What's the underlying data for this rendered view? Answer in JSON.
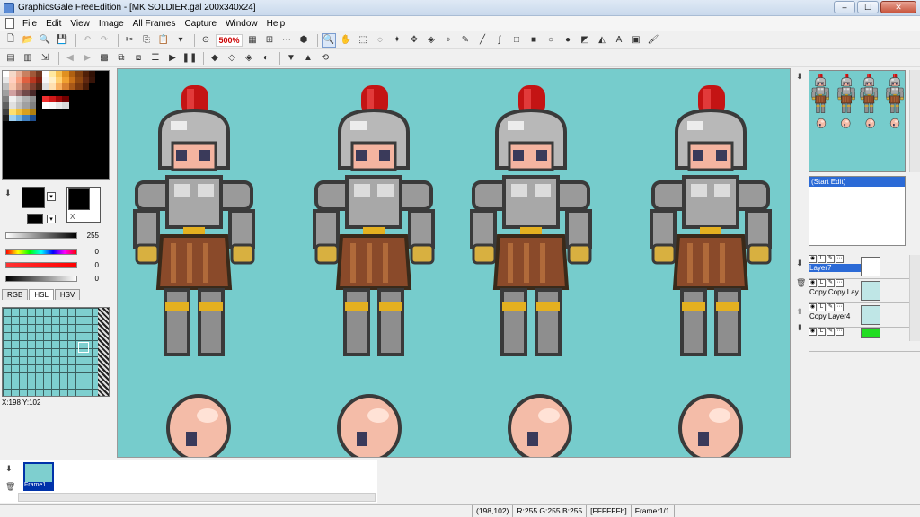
{
  "window": {
    "title": "GraphicsGale FreeEdition - [MK SOLDIER.gal 200x340x24]",
    "minimize": "–",
    "maximize": "☐",
    "close": "✕"
  },
  "menu": [
    "File",
    "Edit",
    "View",
    "Image",
    "All Frames",
    "Capture",
    "Window",
    "Help"
  ],
  "toolbar": {
    "zoom": "500%"
  },
  "colors": {
    "canvas_bg": "#76cccc",
    "selection": "#2b6ad6",
    "primary_fg": "#000000",
    "primary_bg": "#ffffff"
  },
  "color_panel": {
    "value_slider": "255",
    "hue": "0",
    "sat": "0",
    "lum": "0",
    "tabs": [
      "RGB",
      "HSL",
      "HSV"
    ]
  },
  "cursor_position": "X:198 Y:102",
  "history": {
    "items": [
      "(Start Edit)"
    ]
  },
  "layers": [
    {
      "name": "Layer7",
      "swatch": "#ffffff"
    },
    {
      "name": "Copy  Copy  Lay",
      "swatch": "#ffffff"
    },
    {
      "name": "Copy  Layer4",
      "swatch": "#ffffff"
    },
    {
      "name": "",
      "swatch": "#22dd22"
    }
  ],
  "frames": {
    "items": [
      "Frame1"
    ]
  },
  "status": {
    "coords": "(198,102)",
    "rgb": "R:255 G:255 B:255",
    "hex": "[FFFFFFh]",
    "frame": "Frame:1/1"
  }
}
